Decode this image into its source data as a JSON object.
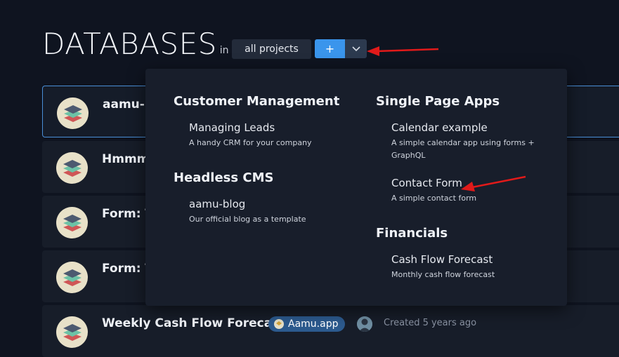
{
  "page": {
    "title": "DATABASES",
    "in_label": "in",
    "project_selector": "all projects",
    "add_button": "+",
    "dropdown_toggle_icon": "chevron-down-icon"
  },
  "databases": [
    {
      "name": "aamu-b"
    },
    {
      "name": "Hmmm"
    },
    {
      "name": "Form: T"
    },
    {
      "name": "Form: T"
    },
    {
      "name": "Weekly Cash Flow Forecast",
      "tag": "Aamu.app",
      "created": "Created 5 years ago"
    }
  ],
  "templates": {
    "left": [
      {
        "section": "Customer Management",
        "items": [
          {
            "name": "Managing Leads",
            "desc": "A handy CRM for your company"
          }
        ]
      },
      {
        "section": "Headless CMS",
        "items": [
          {
            "name": "aamu-blog",
            "desc": "Our official blog as a template"
          }
        ]
      }
    ],
    "right": [
      {
        "section": "Single Page Apps",
        "items": [
          {
            "name": "Calendar example",
            "desc": "A simple calendar app using forms + GraphQL"
          },
          {
            "name": "Contact Form",
            "desc": "A simple contact form"
          }
        ]
      },
      {
        "section": "Financials",
        "items": [
          {
            "name": "Cash Flow Forecast",
            "desc": "Monthly cash flow forecast"
          }
        ]
      }
    ]
  },
  "colors": {
    "background": "#0f1420",
    "card": "#171d29",
    "dropdown": "#181e2b",
    "accent": "#3a95ec",
    "tag": "#2c5a8e",
    "annotation_arrow": "#e11a1a"
  }
}
